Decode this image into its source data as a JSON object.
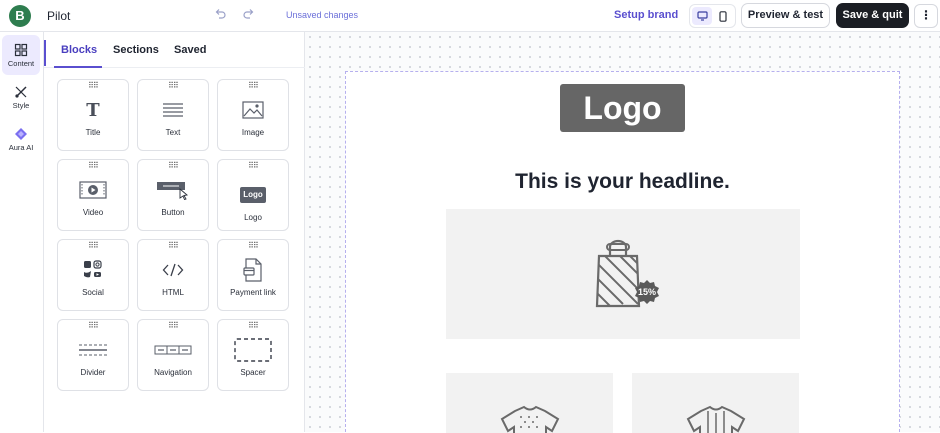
{
  "app": {
    "brand_initial": "B",
    "name": "Pilot",
    "status": "Unsaved changes"
  },
  "toolbar": {
    "setup_brand": "Setup brand",
    "preview_label": "Preview & test",
    "save_label": "Save & quit",
    "more_label": "⋮",
    "undo_icon": "undo-icon",
    "redo_icon": "redo-icon",
    "device_active": "desktop"
  },
  "rail": {
    "items": [
      {
        "label": "Content",
        "icon": "grid-icon",
        "active": true
      },
      {
        "label": "Style",
        "icon": "brush-icon",
        "active": false
      },
      {
        "label": "Aura AI",
        "icon": "diamond-icon",
        "active": false
      }
    ]
  },
  "panel": {
    "tabs": [
      {
        "label": "Blocks",
        "active": true
      },
      {
        "label": "Sections",
        "active": false
      },
      {
        "label": "Saved",
        "active": false
      }
    ],
    "blocks": [
      {
        "label": "Title",
        "icon": "title-icon"
      },
      {
        "label": "Text",
        "icon": "text-icon"
      },
      {
        "label": "Image",
        "icon": "image-icon"
      },
      {
        "label": "Video",
        "icon": "video-icon"
      },
      {
        "label": "Button",
        "icon": "button-icon"
      },
      {
        "label": "Logo",
        "icon": "logo-icon"
      },
      {
        "label": "Social",
        "icon": "social-icon"
      },
      {
        "label": "HTML",
        "icon": "code-icon"
      },
      {
        "label": "Payment link",
        "icon": "payment-link-icon"
      },
      {
        "label": "Divider",
        "icon": "divider-icon"
      },
      {
        "label": "Navigation",
        "icon": "navigation-icon"
      },
      {
        "label": "Spacer",
        "icon": "spacer-icon"
      }
    ]
  },
  "email": {
    "logo_text": "Logo",
    "headline": "This is your headline.",
    "discount_badge": "15%"
  },
  "colors": {
    "accent": "#5a4fcf",
    "primary_button": "#1b1e24",
    "brand": "#2e7d4f"
  }
}
